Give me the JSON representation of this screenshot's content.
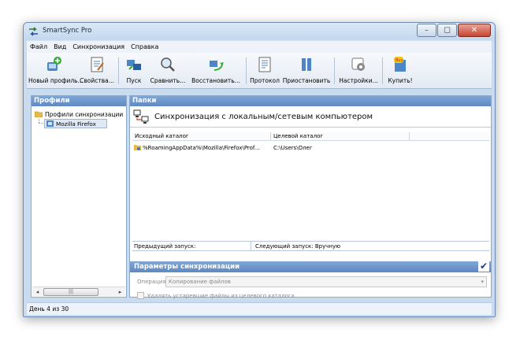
{
  "window": {
    "title": "SmartSync Pro"
  },
  "menu": [
    "Файл",
    "Вид",
    "Синхронизация",
    "Справка"
  ],
  "toolbar": {
    "new_profile": "Новый профиль...",
    "properties": "Свойства...",
    "run": "Пуск",
    "compare": "Сравнить...",
    "restore": "Восстановить...",
    "log": "Протокол",
    "pause": "Приостановить",
    "settings": "Настройки...",
    "buy": "Купить!"
  },
  "profiles_panel": {
    "header": "Профили",
    "root": "Профили синхронизации",
    "child": "Mozilla Firefox"
  },
  "folders_panel": {
    "header": "Папки",
    "sync_type": "Синхронизация с локальным/сетевым компьютером",
    "columns": [
      "Исходный каталог",
      "Целевой каталог"
    ],
    "rows": [
      {
        "source": "%RoamingAppData%\\Mozilla\\Firefox\\Prof...",
        "target": "C:\\Users\\Олег"
      }
    ],
    "prev_run_label": "Предыдущий запуск:",
    "next_run_label": "Следующий запуск: Вручную"
  },
  "params": {
    "header": "Параметры синхронизации",
    "operation_label": "Операция",
    "operation_value": "Копирование файлов",
    "delete_obsolete_label": "Удалять устаревшие файлы из целевого каталога",
    "delete_obsolete_checked": false
  },
  "status": {
    "text": "День 4 из 30"
  },
  "colors": {
    "accent": "#5f89c3",
    "frame": "#c9dcef"
  }
}
